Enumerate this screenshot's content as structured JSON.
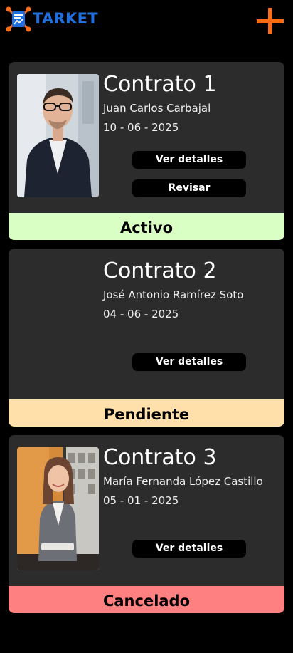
{
  "app": {
    "brand": "TARKET",
    "colors": {
      "brand_blue": "#1f6fe0",
      "brand_orange": "#ff6a13",
      "card_bg": "#2c2c2c"
    },
    "icons": {
      "logo": "tarket-logo-icon",
      "add": "plus-icon"
    }
  },
  "contracts": [
    {
      "title": "Contrato 1",
      "name": "Juan Carlos Carbajal",
      "date": "10 - 06 - 2025",
      "buttons": [
        "Ver detalles",
        "Revisar"
      ],
      "status": "Activo",
      "status_color": "#d9ffc4",
      "has_photo": true
    },
    {
      "title": "Contrato 2",
      "name": "José Antonio Ramírez Soto",
      "date": "04 - 06 - 2025",
      "buttons": [
        "Ver detalles"
      ],
      "status": "Pendiente",
      "status_color": "#ffdfaa",
      "has_photo": false
    },
    {
      "title": "Contrato 3",
      "name": "María Fernanda López Castillo",
      "date": "05 - 01 - 2025",
      "buttons": [
        "Ver detalles"
      ],
      "status": "Cancelado",
      "status_color": "#ff8080",
      "has_photo": true
    }
  ]
}
